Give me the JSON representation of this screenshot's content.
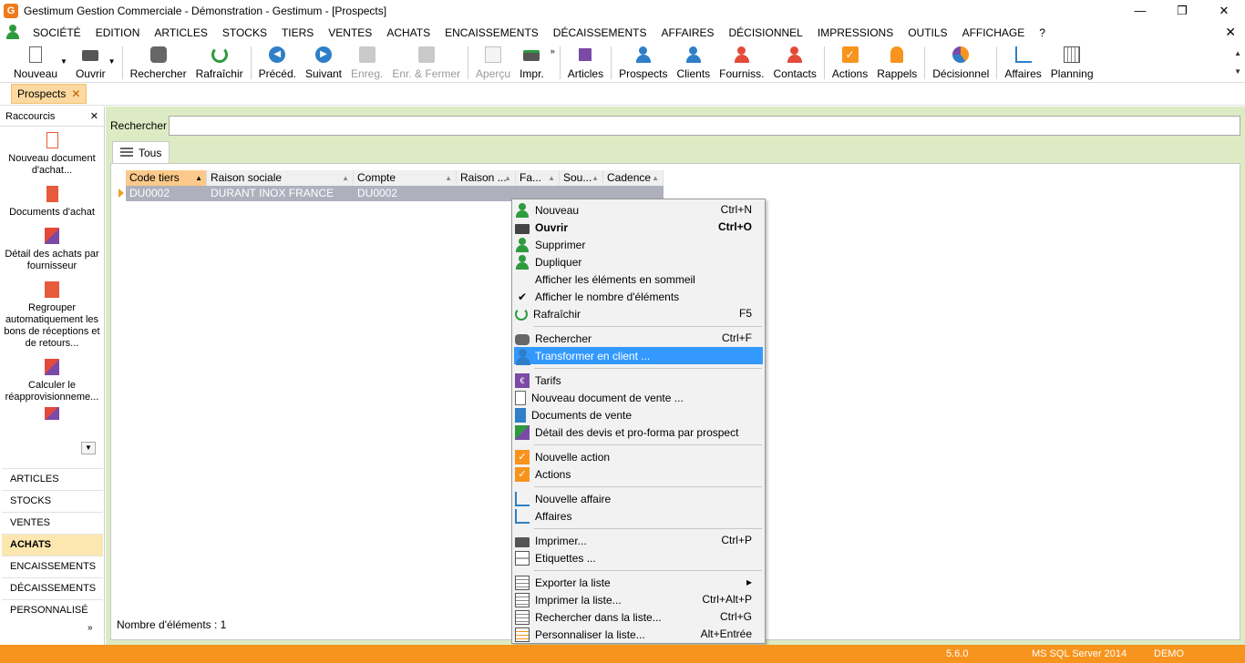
{
  "window": {
    "title": "Gestimum Gestion Commerciale - Démonstration - Gestimum - [Prospects]",
    "logo_letter": "G",
    "controls": {
      "minimize": "—",
      "restore": "❐",
      "close": "✕"
    }
  },
  "menu": {
    "items": [
      "SOCIÉTÉ",
      "EDITION",
      "ARTICLES",
      "STOCKS",
      "TIERS",
      "VENTES",
      "ACHATS",
      "ENCAISSEMENTS",
      "DÉCAISSEMENTS",
      "AFFAIRES",
      "DÉCISIONNEL",
      "IMPRESSIONS",
      "OUTILS",
      "AFFICHAGE",
      "?"
    ],
    "close": "✕"
  },
  "toolbar": {
    "nouveau": "Nouveau",
    "ouvrir": "Ouvrir",
    "rechercher": "Rechercher",
    "rafraichir": "Rafraîchir",
    "preced": "Précéd.",
    "suivant": "Suivant",
    "enreg": "Enreg.",
    "enr_fermer": "Enr. & Fermer",
    "apercu": "Aperçu",
    "impr": "Impr.",
    "articles": "Articles",
    "prospects": "Prospects",
    "clients": "Clients",
    "fourniss": "Fourniss.",
    "contacts": "Contacts",
    "actions": "Actions",
    "rappels": "Rappels",
    "decisionnel": "Décisionnel",
    "affaires": "Affaires",
    "planning": "Planning"
  },
  "tab": {
    "label": "Prospects",
    "close": "✕"
  },
  "sidebar": {
    "title": "Raccourcis",
    "close": "✕",
    "shortcuts": [
      "Nouveau document d'achat...",
      "Documents d'achat",
      "Détail des achats par fournisseur",
      "Regrouper automatiquement les bons de réceptions et de retours...",
      "Calculer le réapprovisionneme..."
    ],
    "modules": [
      "ARTICLES",
      "STOCKS",
      "VENTES",
      "ACHATS",
      "ENCAISSEMENTS",
      "DÉCAISSEMENTS",
      "PERSONNALISÉ"
    ]
  },
  "main": {
    "search_label": "Rechercher",
    "search_value": "",
    "list_tab": "Tous",
    "columns": [
      "Code tiers",
      "Raison sociale",
      "Compte",
      "Raison ...",
      "Fa...",
      "Sou...",
      "Cadence"
    ],
    "rows": [
      {
        "code": "DU0002",
        "raison": "DURANT INOX FRANCE",
        "compte": "DU0002"
      }
    ],
    "count": "Nombre d'éléments : 1"
  },
  "context_menu": {
    "nouveau": {
      "label": "Nouveau",
      "shortcut": "Ctrl+N"
    },
    "ouvrir": {
      "label": "Ouvrir",
      "shortcut": "Ctrl+O"
    },
    "supprimer": {
      "label": "Supprimer"
    },
    "dupliquer": {
      "label": "Dupliquer"
    },
    "sommeil": {
      "label": "Afficher les éléments en sommeil"
    },
    "nombre": {
      "label": "Afficher le nombre d'éléments"
    },
    "rafraichir": {
      "label": "Rafraîchir",
      "shortcut": "F5"
    },
    "rechercher": {
      "label": "Rechercher",
      "shortcut": "Ctrl+F"
    },
    "transformer": {
      "label": "Transformer en client ..."
    },
    "tarifs": {
      "label": "Tarifs"
    },
    "nouveau_doc": {
      "label": "Nouveau document de vente ..."
    },
    "docs_vente": {
      "label": "Documents de vente"
    },
    "detail_devis": {
      "label": "Détail des devis et pro-forma par prospect"
    },
    "nouvelle_action": {
      "label": "Nouvelle action"
    },
    "actions": {
      "label": "Actions"
    },
    "nouvelle_affaire": {
      "label": "Nouvelle affaire"
    },
    "affaires": {
      "label": "Affaires"
    },
    "imprimer": {
      "label": "Imprimer...",
      "shortcut": "Ctrl+P"
    },
    "etiquettes": {
      "label": "Etiquettes ..."
    },
    "exporter": {
      "label": "Exporter la liste",
      "arrow": "▸"
    },
    "imprimer_liste": {
      "label": "Imprimer la liste...",
      "shortcut": "Ctrl+Alt+P"
    },
    "rechercher_liste": {
      "label": "Rechercher dans la liste...",
      "shortcut": "Ctrl+G"
    },
    "personnaliser": {
      "label": "Personnaliser la liste...",
      "shortcut": "Alt+Entrée"
    }
  },
  "status": {
    "version": "5.6.0",
    "server": "MS SQL Server 2014",
    "database": "DEMO"
  },
  "colors": {
    "accent_orange": "#f7941d",
    "main_bg": "#ddebc4",
    "highlight": "#3399ff",
    "selected_row": "#aeb1bd"
  }
}
